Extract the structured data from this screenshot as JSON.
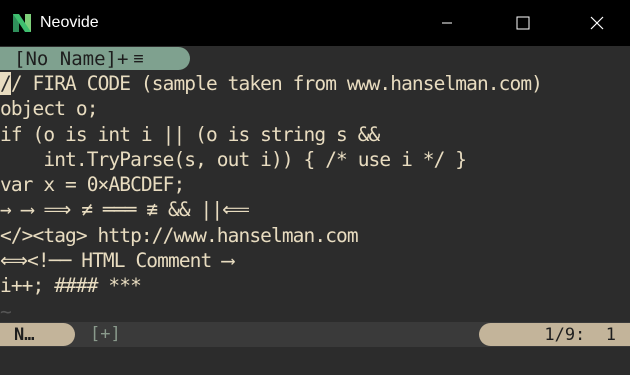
{
  "window": {
    "title": "Neovide",
    "icon": "neovide-logo-icon",
    "controls": [
      "minimize-icon",
      "maximize-icon",
      "close-icon"
    ]
  },
  "tabline": {
    "active_tab_label": "[No Name]+",
    "tab_icon": "list-icon"
  },
  "buffer": {
    "lines": [
      "/ FIRA CODE (sample taken from www.hanselman.com)",
      "object o;",
      "if (o is int i || (o is string s &&",
      "    int.TryParse(s, out i)) { /* use i */ }",
      "var x = 0×ABCDEF;",
      "→ ⟶ ⟹ ≠ ═══ ≢ && ||⟸",
      "</><tag> http://www.hanselman.com",
      "⟺<!── HTML Comment ⟶",
      "i++; #### ***"
    ],
    "cursor_char": "/",
    "empty_line_marker": "~"
  },
  "statusline": {
    "mode": "N…",
    "modified": "[+]",
    "position": "1/9:  1"
  },
  "colors": {
    "background": "#2c2c2c",
    "foreground": "#e8dcc0",
    "tab_bg": "#7fa18f",
    "status_pill": "#c3b49a",
    "titlebar": "#000000"
  }
}
